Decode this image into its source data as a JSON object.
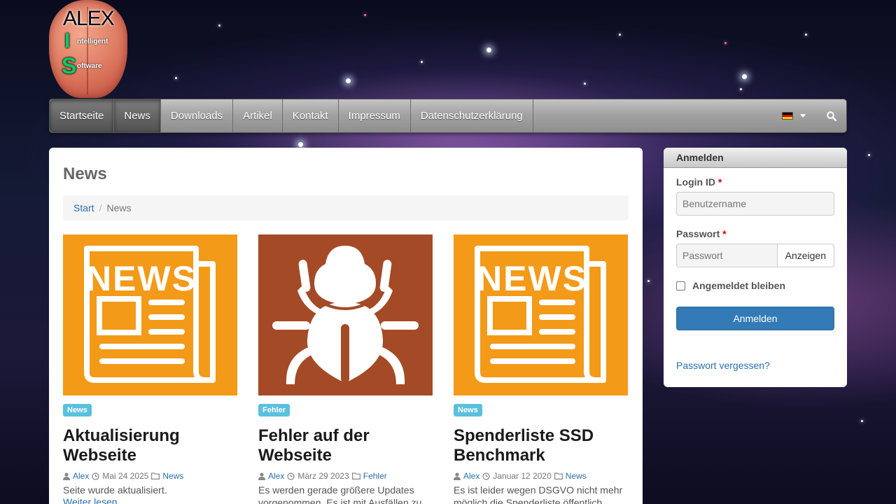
{
  "logo": {
    "line1": "ALEX",
    "letter_i": "I",
    "word_i": "ntelligent",
    "letter_s": "S",
    "word_s": "oftware"
  },
  "nav": {
    "items": [
      {
        "label": "Startseite",
        "active": true
      },
      {
        "label": "News",
        "active": true
      },
      {
        "label": "Downloads",
        "active": false
      },
      {
        "label": "Artikel",
        "active": false
      },
      {
        "label": "Kontakt",
        "active": false
      },
      {
        "label": "Impressum",
        "active": false
      },
      {
        "label": "Datenschutzerklärung",
        "active": false
      }
    ],
    "language_icon": "german-flag-icon",
    "search_icon": "search-icon"
  },
  "main": {
    "title": "News",
    "breadcrumb": {
      "home": "Start",
      "current": "News"
    },
    "cards": [
      {
        "image": "newspaper-icon",
        "image_bg": "#f39a18",
        "category": "News",
        "title": "Aktualisierung Webseite",
        "author": "Alex",
        "date": "Mai 24 2025",
        "category_link": "News",
        "excerpt": "Seite wurde aktualisiert.",
        "readmore": "Weiter lesen"
      },
      {
        "image": "bug-icon",
        "image_bg": "#a44a27",
        "category": "Fehler",
        "title": "Fehler auf der Webseite",
        "author": "Alex",
        "date": "März 29 2023",
        "category_link": "Fehler",
        "excerpt": "Es werden gerade größere Updates vorgenommen. Es ist mit Ausfällen zu"
      },
      {
        "image": "newspaper-icon",
        "image_bg": "#f39a18",
        "category": "News",
        "title": "Spenderliste SSD Benchmark",
        "author": "Alex",
        "date": "Januar 12 2020",
        "category_link": "News",
        "excerpt": "Es ist leider wegen DSGVO nicht mehr möglich die Spenderliste öffentlich"
      }
    ]
  },
  "login": {
    "title": "Anmelden",
    "login_id_label": "Login ID",
    "required_mark": "*",
    "username_placeholder": "Benutzername",
    "password_label": "Passwort",
    "password_placeholder": "Passwort",
    "show_button": "Anzeigen",
    "remember_label": "Angemeldet bleiben",
    "submit_button": "Anmelden",
    "forgot_link": "Passwort vergessen?"
  },
  "colors": {
    "link": "#2a6fb0",
    "primary": "#337ab7",
    "badge": "#5bc0de"
  }
}
